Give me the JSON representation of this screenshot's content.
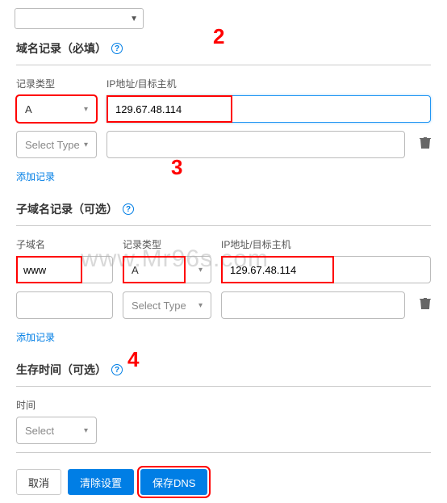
{
  "annotations": {
    "two": "2",
    "three": "3",
    "four": "4"
  },
  "watermark": "www.Mr96s.com",
  "section1": {
    "title": "域名记录（必填）",
    "labels": {
      "type": "记录类型",
      "ip": "IP地址/目标主机"
    },
    "row1": {
      "type_value": "A",
      "ip_value": "129.67.48.114"
    },
    "row2": {
      "type_placeholder": "Select Type",
      "ip_value": ""
    },
    "add": "添加记录"
  },
  "section2": {
    "title": "子域名记录（可选）",
    "labels": {
      "subdomain": "子域名",
      "type": "记录类型",
      "ip": "IP地址/目标主机"
    },
    "row1": {
      "subdomain_value": "www",
      "type_value": "A",
      "ip_value": "129.67.48.114"
    },
    "row2": {
      "subdomain_value": "",
      "type_placeholder": "Select Type",
      "ip_value": ""
    },
    "add": "添加记录"
  },
  "section3": {
    "title": "生存时间（可选）",
    "label": "时间",
    "value": "Select"
  },
  "buttons": {
    "cancel": "取消",
    "clear": "清除设置",
    "save": "保存DNS"
  }
}
